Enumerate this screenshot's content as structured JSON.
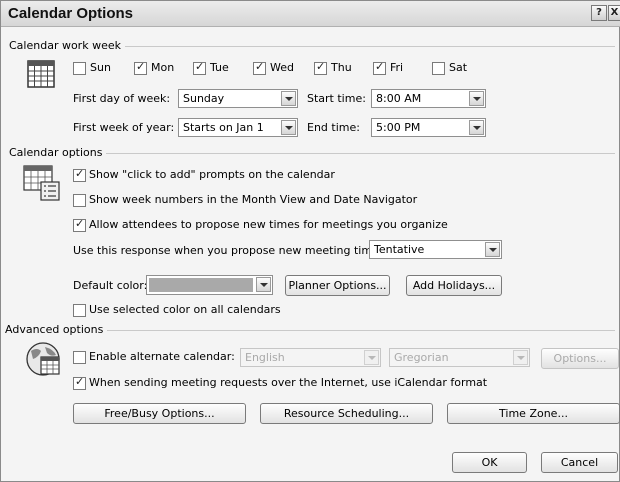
{
  "dialog": {
    "title": "Calendar Options",
    "help_glyph": "?",
    "close_glyph": "X"
  },
  "work_week": {
    "section_label": "Calendar work week",
    "days": [
      {
        "label": "Sun",
        "checked": false
      },
      {
        "label": "Mon",
        "checked": true
      },
      {
        "label": "Tue",
        "checked": true
      },
      {
        "label": "Wed",
        "checked": true
      },
      {
        "label": "Thu",
        "checked": true
      },
      {
        "label": "Fri",
        "checked": true
      },
      {
        "label": "Sat",
        "checked": false
      }
    ],
    "first_day_label": "First day of week:",
    "first_day_value": "Sunday",
    "start_time_label": "Start time:",
    "start_time_value": "8:00 AM",
    "first_week_label": "First week of year:",
    "first_week_value": "Starts on Jan 1",
    "end_time_label": "End time:",
    "end_time_value": "5:00 PM"
  },
  "calendar_options": {
    "section_label": "Calendar options",
    "click_to_add_label": "Show \"click to add\" prompts on the calendar",
    "click_to_add_checked": true,
    "week_numbers_label": "Show week numbers in the Month View and Date Navigator",
    "week_numbers_checked": false,
    "allow_propose_label": "Allow attendees to propose new times for meetings you organize",
    "allow_propose_checked": true,
    "response_label": "Use this response when you propose new meeting times:",
    "response_value": "Tentative",
    "default_color_label": "Default color:",
    "default_color": "#a9a9a9",
    "planner_button": "Planner Options...",
    "holidays_button": "Add Holidays...",
    "selected_color_label": "Use selected color on all calendars",
    "selected_color_checked": false
  },
  "advanced": {
    "section_label": "Advanced options",
    "alt_calendar_label": "Enable alternate calendar:",
    "alt_calendar_checked": false,
    "language_value": "English",
    "calendar_type_value": "Gregorian",
    "options_button": "Options...",
    "icalendar_label": "When sending meeting requests over the Internet, use iCalendar format",
    "icalendar_checked": true,
    "freebusy_button": "Free/Busy Options...",
    "resource_button": "Resource Scheduling...",
    "timezone_button": "Time Zone..."
  },
  "footer": {
    "ok_button": "OK",
    "cancel_button": "Cancel"
  },
  "icons": {
    "work_week": "calendar-grid-icon",
    "calendar_options": "calendar-options-icon",
    "advanced": "globe-calendar-icon"
  }
}
